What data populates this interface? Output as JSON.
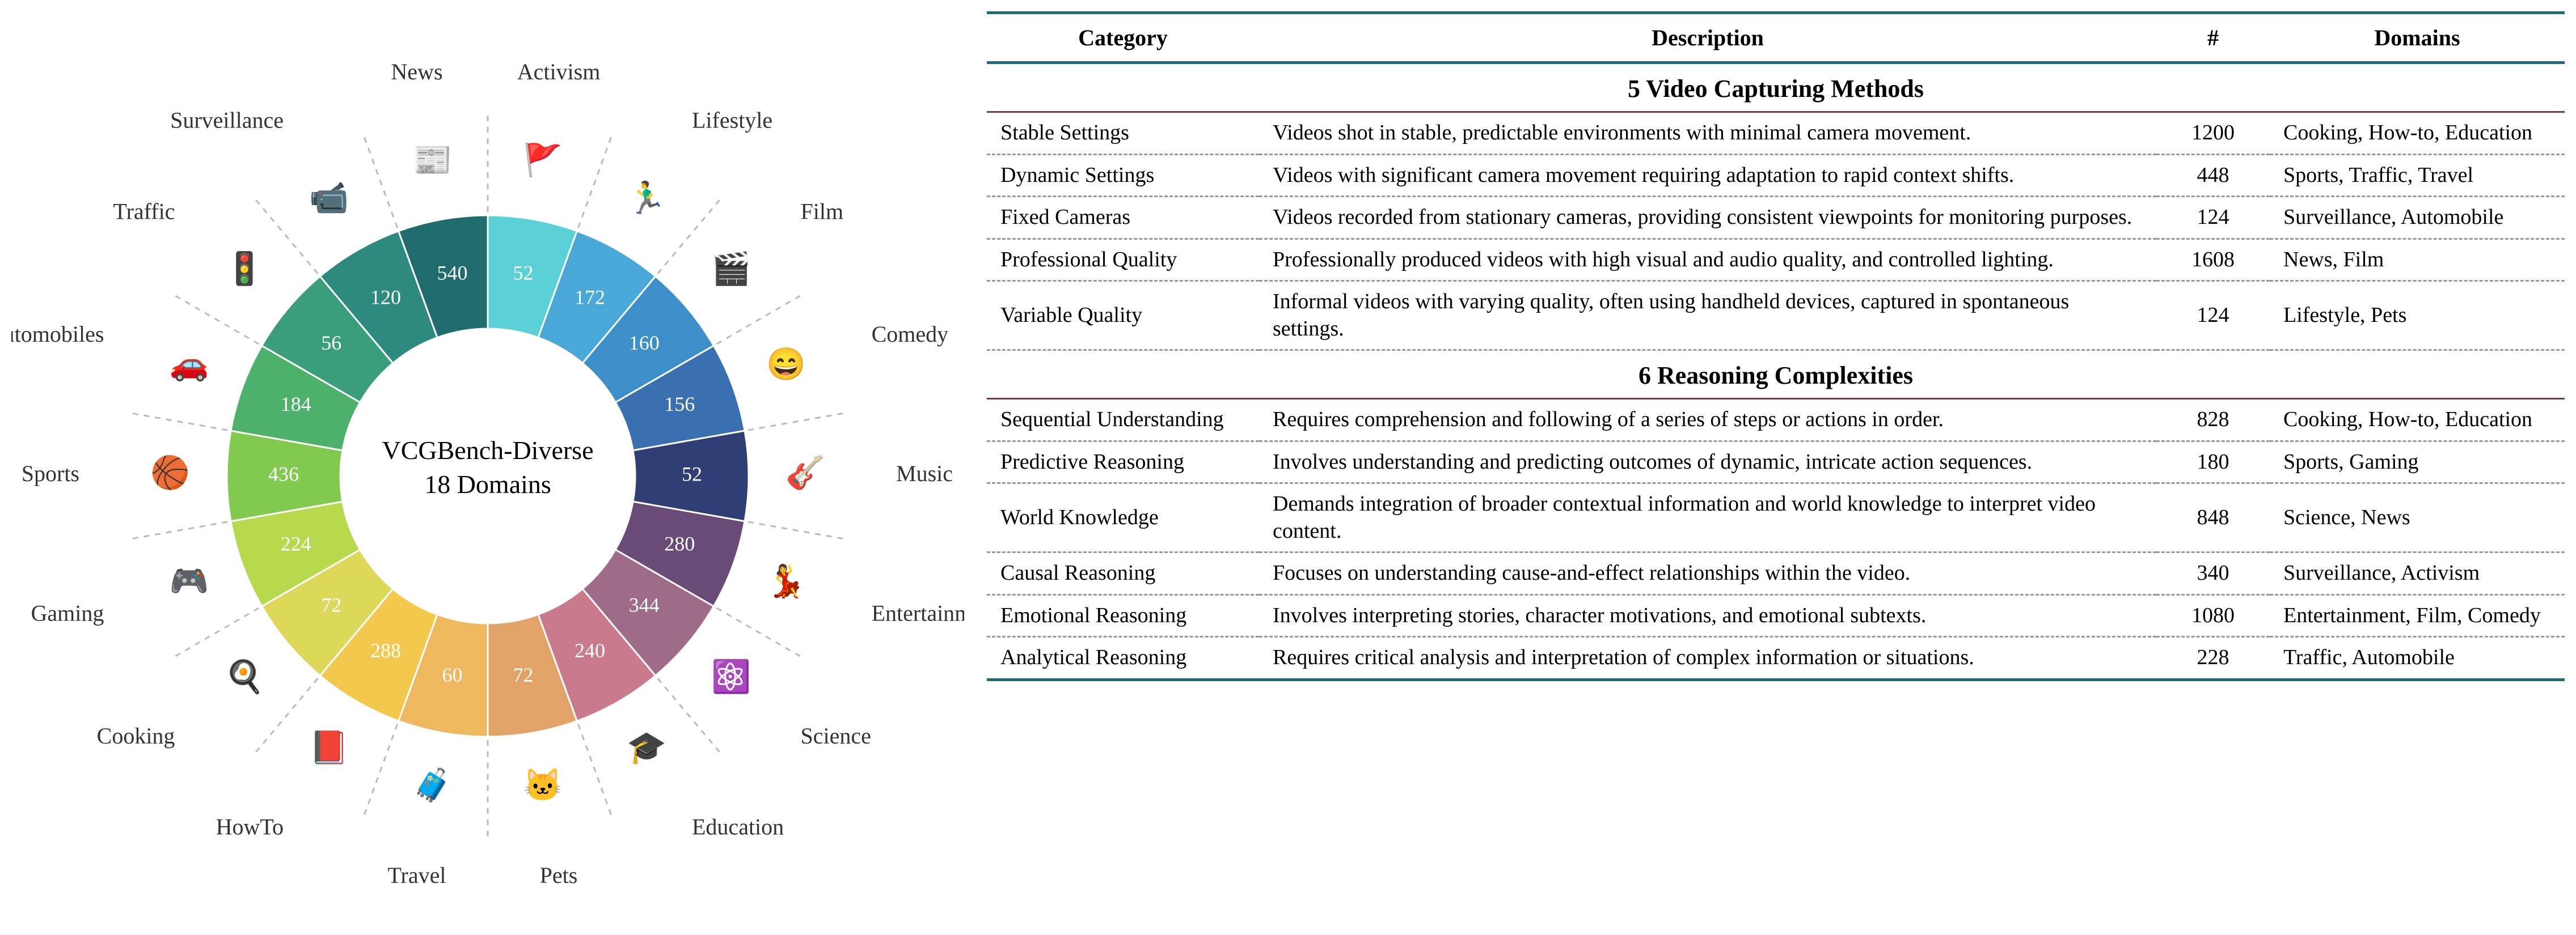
{
  "chart_data": {
    "type": "pie",
    "title": "VCGBench-Diverse",
    "subtitle": "18 Domains",
    "slices": [
      {
        "label": "Activism",
        "value": 52,
        "color": "#5bd1d7",
        "icon": "🚩"
      },
      {
        "label": "Lifestyle",
        "value": 172,
        "color": "#4aa8d8",
        "icon": "🏃‍♂️"
      },
      {
        "label": "Film",
        "value": 160,
        "color": "#3c8fc9",
        "icon": "🎬"
      },
      {
        "label": "Comedy",
        "value": 156,
        "color": "#3a6fb0",
        "icon": "😄"
      },
      {
        "label": "Music",
        "value": 52,
        "color": "#2f3e75",
        "icon": "🎸"
      },
      {
        "label": "Entertainment",
        "value": 280,
        "color": "#6a4b78",
        "icon": "💃"
      },
      {
        "label": "Science",
        "value": 344,
        "color": "#9e6c87",
        "icon": "⚛️"
      },
      {
        "label": "Education",
        "value": 240,
        "color": "#c97a8c",
        "icon": "🎓"
      },
      {
        "label": "Pets",
        "value": 72,
        "color": "#e1a368",
        "icon": "🐱"
      },
      {
        "label": "Travel",
        "value": 60,
        "color": "#f0b85e",
        "icon": "🧳"
      },
      {
        "label": "HowTo",
        "value": 288,
        "color": "#f2c94c",
        "icon": "📕"
      },
      {
        "label": "Cooking",
        "value": 72,
        "color": "#ddd75a",
        "icon": "🍳"
      },
      {
        "label": "Gaming",
        "value": 224,
        "color": "#b8d94e",
        "icon": "🎮"
      },
      {
        "label": "Sports",
        "value": 436,
        "color": "#82c94f",
        "icon": "🏀"
      },
      {
        "label": "Automobiles",
        "value": 184,
        "color": "#4db06b",
        "icon": "🚗"
      },
      {
        "label": "Traffic",
        "value": 56,
        "color": "#3a9e7c",
        "icon": "🚦"
      },
      {
        "label": "Surveillance",
        "value": 120,
        "color": "#2d8a7e",
        "icon": "📹"
      },
      {
        "label": "News",
        "value": 540,
        "color": "#1f6b6e",
        "icon": "📰"
      }
    ]
  },
  "table": {
    "headers": [
      "Category",
      "Description",
      "#",
      "Domains"
    ],
    "sections": [
      {
        "title": "5 Video Capturing Methods",
        "rows": [
          {
            "category": "Stable Settings",
            "desc": "Videos shot in stable, predictable environments with minimal camera movement.",
            "count": 1200,
            "domains": "Cooking, How-to, Education"
          },
          {
            "category": "Dynamic Settings",
            "desc": "Videos with significant camera movement requiring adaptation to rapid context shifts.",
            "count": 448,
            "domains": "Sports, Traffic, Travel"
          },
          {
            "category": "Fixed Cameras",
            "desc": "Videos recorded from stationary cameras, providing consistent viewpoints for monitoring purposes.",
            "count": 124,
            "domains": "Surveillance, Automobile"
          },
          {
            "category": "Professional Quality",
            "desc": "Professionally produced videos with high visual and audio quality, and controlled lighting.",
            "count": 1608,
            "domains": "News, Film"
          },
          {
            "category": "Variable Quality",
            "desc": "Informal videos with varying quality, often using handheld devices, captured in spontaneous settings.",
            "count": 124,
            "domains": "Lifestyle, Pets"
          }
        ]
      },
      {
        "title": "6 Reasoning Complexities",
        "rows": [
          {
            "category": "Sequential Understanding",
            "desc": "Requires comprehension and following of a series of steps or actions in order.",
            "count": 828,
            "domains": "Cooking, How-to, Education"
          },
          {
            "category": "Predictive Reasoning",
            "desc": "Involves understanding and predicting outcomes of dynamic, intricate action sequences.",
            "count": 180,
            "domains": "Sports, Gaming"
          },
          {
            "category": "World Knowledge",
            "desc": "Demands integration of broader contextual information and world knowledge to interpret video content.",
            "count": 848,
            "domains": "Science, News"
          },
          {
            "category": "Causal Reasoning",
            "desc": "Focuses on understanding cause-and-effect relationships within the video.",
            "count": 340,
            "domains": "Surveillance, Activism"
          },
          {
            "category": "Emotional Reasoning",
            "desc": "Involves interpreting stories, character motivations, and emotional subtexts.",
            "count": 1080,
            "domains": "Entertainment, Film, Comedy"
          },
          {
            "category": "Analytical Reasoning",
            "desc": "Requires critical analysis and interpretation of complex information or situations.",
            "count": 228,
            "domains": "Traffic, Automobile"
          }
        ]
      }
    ]
  }
}
